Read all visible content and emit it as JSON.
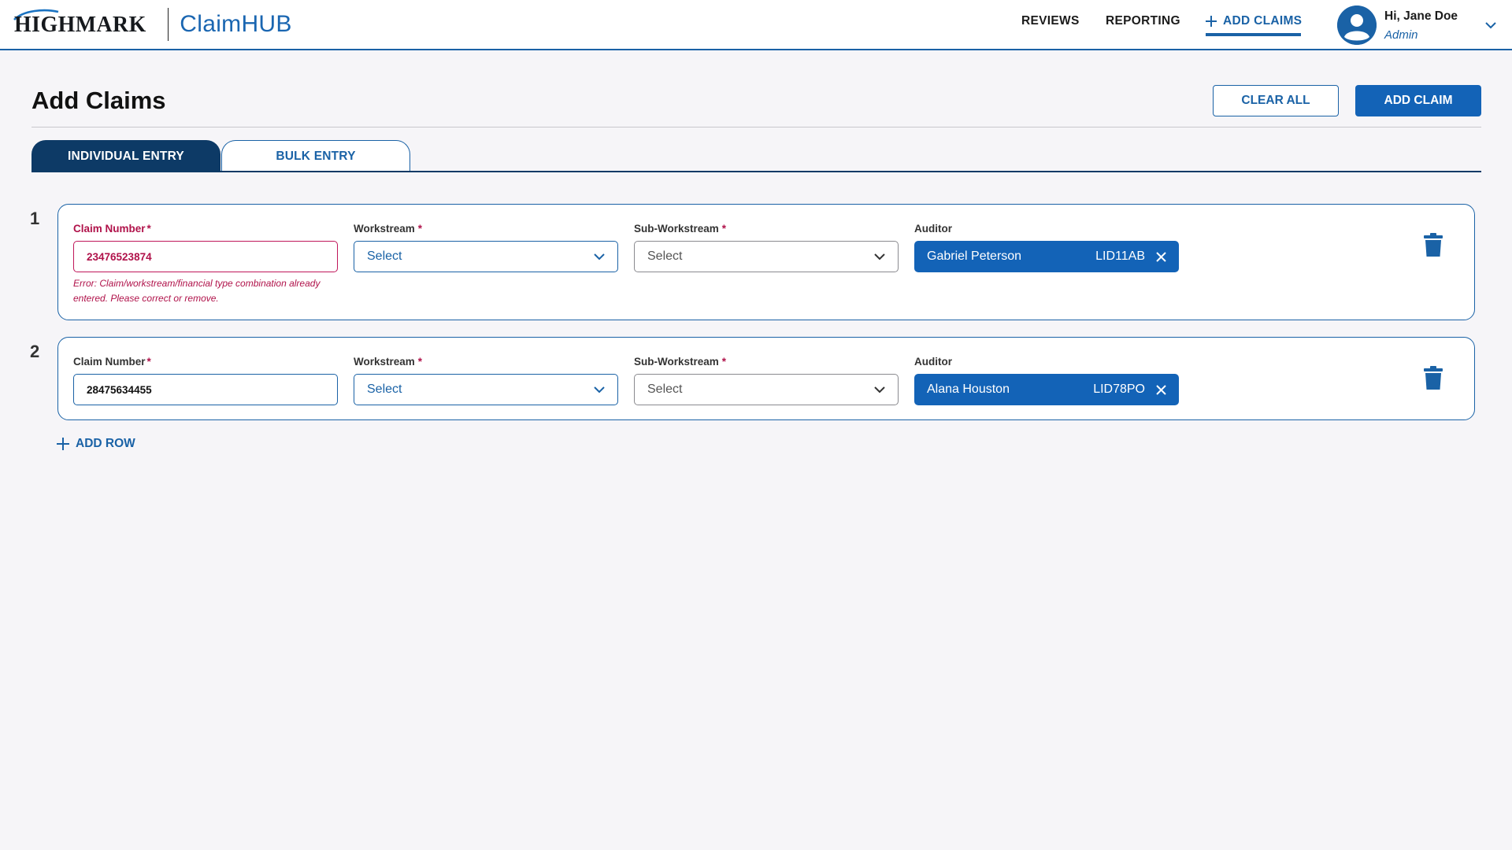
{
  "header": {
    "logo_text": "HIGHMARK",
    "app_name": "ClaimHUB",
    "nav": {
      "reviews": "REVIEWS",
      "reporting": "REPORTING",
      "add_claims": "ADD CLAIMS"
    },
    "user": {
      "greeting": "Hi, Jane Doe",
      "role": "Admin"
    }
  },
  "page": {
    "title": "Add Claims",
    "clear_all_label": "CLEAR ALL",
    "add_claim_label": "ADD CLAIM"
  },
  "tabs": {
    "individual": "INDIVIDUAL ENTRY",
    "bulk": "BULK ENTRY"
  },
  "labels": {
    "claim_number": "Claim Number",
    "workstream": "Workstream",
    "sub_workstream": "Sub-Workstream",
    "auditor": "Auditor",
    "required_mark": "*"
  },
  "rows": [
    {
      "number": "1",
      "claim_number": "23476523874",
      "workstream": "Select",
      "sub_workstream": "Select",
      "auditor_name": "Gabriel Peterson",
      "auditor_id": "LID11AB",
      "error": "Error: Claim/workstream/financial type combination already entered. Please correct or remove."
    },
    {
      "number": "2",
      "claim_number": "28475634455",
      "workstream": "Select",
      "sub_workstream": "Select",
      "auditor_name": "Alana Houston",
      "auditor_id": "LID78PO"
    }
  ],
  "add_row_label": "ADD ROW",
  "colors": {
    "primary": "#1a62a6",
    "dark_navy": "#0d3a66",
    "error": "#b0124a",
    "background": "#f6f5f8"
  },
  "icons": [
    "user-avatar-icon",
    "chevron-down-icon",
    "plus-icon",
    "close-icon",
    "trash-icon"
  ]
}
